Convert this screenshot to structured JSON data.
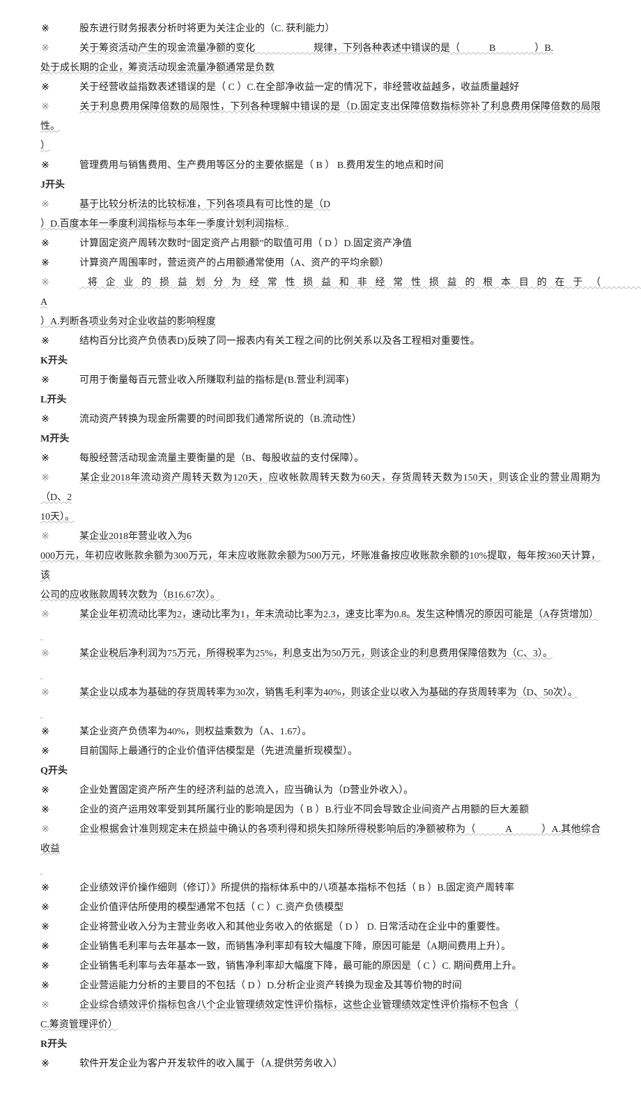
{
  "bullets": {
    "solid": "※",
    "hollow": "※"
  },
  "lines": [
    {
      "type": "item",
      "bullet": "solid",
      "text": "股东进行财务报表分析时将更为关注企业的（C. 获利能力）"
    },
    {
      "type": "item",
      "bullet": "hollow",
      "text": "关于筹资活动产生的现金流量净额的变化　　　　　　规律，下列各种表述中错误的是（　　　B　　　　）B.",
      "wavy": true
    },
    {
      "type": "cont",
      "text": "处于成长期的企业，筹资活动现金流量净额通常是负数",
      "wavy": true
    },
    {
      "type": "item",
      "bullet": "solid",
      "text": "关于经营收益指数表述错误的是（ C ）C.在全部净收益一定的情况下，非经营收益越多，收益质量越好"
    },
    {
      "type": "item",
      "bullet": "hollow",
      "text": "关于利息费用保障倍数的局限性，下列各种理解中错误的是（D.固定支出保障倍数指标弥补了利息费用保障倍数的局限性。",
      "wavy": true
    },
    {
      "type": "cont",
      "text": "）",
      "wavy": true
    },
    {
      "type": "item",
      "bullet": "solid",
      "text": "管理费用与销售费用、生产费用等区分的主要依据是（ B ）  B.费用发生的地点和时间"
    },
    {
      "type": "head",
      "text": "J开头"
    },
    {
      "type": "item",
      "bullet": "hollow",
      "text": "基于比较分析法的比较标准，下列各项具有可比性的是（D",
      "wavy": true
    },
    {
      "type": "cont",
      "text": "）D.百度本年一季度利润指标与本年一季度计划利润指标..",
      "wavy": true
    },
    {
      "type": "item",
      "bullet": "solid",
      "text": "计算固定资产周转次数时“固定资产占用额”的取值可用（ D ）D.固定资产净值"
    },
    {
      "type": "item",
      "bullet": "solid",
      "text": "计算资产周围率时，营运资产的占用额通常使用（A、资产的平均余额）"
    },
    {
      "type": "item",
      "bullet": "hollow",
      "text": "将企业的损益划分为经常性损益和非经常性损益的根本目的在于（　　　　　　　　　　　　　　　　　　　　　　　　　　A",
      "wavy": true
    },
    {
      "type": "cont",
      "text": "）A.判断各项业务对企业收益的影响程度",
      "wavy": true
    },
    {
      "type": "item",
      "bullet": "solid",
      "text": "结构百分比资产负债表D)反映了同一报表内有关工程之间的比例关系以及各工程相对重要性。"
    },
    {
      "type": "head",
      "text": "K开头"
    },
    {
      "type": "item",
      "bullet": "solid",
      "text": "可用于衡量每百元营业收入所赚取利益的指标是(B.营业利润率)"
    },
    {
      "type": "head",
      "text": "L开头"
    },
    {
      "type": "item",
      "bullet": "solid",
      "text": "流动资产转换为现金所需要的时间即我们通常所说的（B.流动性）"
    },
    {
      "type": "head",
      "text": "M开头"
    },
    {
      "type": "item",
      "bullet": "solid",
      "text": "每股经营活动现金流量主要衡量的是（B、每股收益的支付保障）。"
    },
    {
      "type": "item",
      "bullet": "hollow",
      "text": "某企业2018年流动资产周转天数为120天，应收帐款周转天数为60天，存货周转天数为150天，则该企业的营业周期为（D、2",
      "wavy": true
    },
    {
      "type": "cont",
      "text": "10天）。",
      "wavy": true
    },
    {
      "type": "item",
      "bullet": "hollow",
      "text": "某企业2018年营业收入为6",
      "wavy": true
    },
    {
      "type": "cont",
      "text": "000万元，年初应收账款余额为300万元，年末应收账款余额为500万元，坏账准备按应收账款余额的10%提取，每年按360天计算，该",
      "wavy": true
    },
    {
      "type": "cont",
      "text": "公司的应收账款周转次数为（B16.67次）。",
      "wavy": true
    },
    {
      "type": "item",
      "bullet": "hollow",
      "text": "某企业年初流动比率为2，速动比率为1，年末流动比率为2.3，速支比率为0.8。发生这种情况的原因可能是（A存货增加）",
      "wavy": true
    },
    {
      "type": "cont",
      "text": " ",
      "wavy": true
    },
    {
      "type": "item",
      "bullet": "hollow",
      "text": "某企业税后净利润为75万元，所得税率为25%，利息支出为50万元，则该企业的利息费用保障倍数为（C、3）。",
      "wavy": true
    },
    {
      "type": "cont",
      "text": " ",
      "wavy": true
    },
    {
      "type": "item",
      "bullet": "hollow",
      "text": "某企业以成本为基础的存货周转率为30次，销售毛利率为40%，则该企业以收入为基础的存货周转率为（D、50次）。",
      "wavy": true
    },
    {
      "type": "cont",
      "text": " ",
      "wavy": true
    },
    {
      "type": "item",
      "bullet": "solid",
      "text": "某企业资产负债率为40%，则权益乘数为（A、1.67）。"
    },
    {
      "type": "item",
      "bullet": "solid",
      "text": "目前国际上最通行的企业价值评估模型是（先进流量折现模型）。"
    },
    {
      "type": "head",
      "text": "Q开头"
    },
    {
      "type": "item",
      "bullet": "solid",
      "text": "企业处置固定资产所产生的经济利益的总流入，应当确认为（D营业外收入）。"
    },
    {
      "type": "item",
      "bullet": "solid",
      "text": "企业的资产运用效率受到其所属行业的影响是因为（ B ）B.行业不同会导致企业间资产占用额的巨大差额"
    },
    {
      "type": "item",
      "bullet": "hollow",
      "text": "企业根据会计准则规定未在损益中确认的各项利得和损失扣除所得税影响后的净额被称为（　　　A　　　）A.其他综合收益",
      "wavy": true
    },
    {
      "type": "cont",
      "text": " ",
      "wavy": true
    },
    {
      "type": "item",
      "bullet": "solid",
      "text": "企业绩效评价操作细则（修订）》所提供的指标体系中的八项基本指标不包括（ B ）B.固定资产周转率"
    },
    {
      "type": "item",
      "bullet": "solid",
      "text": "企业价值评估所使用的模型通常不包括（ C ）C.资产负债模型"
    },
    {
      "type": "item",
      "bullet": "solid",
      "text": "企业将营业收入分为主营业务收入和其他业务收入的依据是（ D ）  D. 日常活动在企业中的重要性。"
    },
    {
      "type": "item",
      "bullet": "solid",
      "text": "企业销售毛利率与去年基本一致，而销售净利率却有较大幅度下降，原因可能是（A期间费用上升）。"
    },
    {
      "type": "item",
      "bullet": "solid",
      "text": "企业销售毛利率与去年基本一致，销售净利率却大幅度下降，最可能的原因是（ C ）C. 期间费用上升。"
    },
    {
      "type": "item",
      "bullet": "solid",
      "text": "企业营运能力分析的主要目的不包括（ D  ）D.分析企业资产转换为现金及其等价物的时间"
    },
    {
      "type": "item",
      "bullet": "hollow",
      "text": "企业综合绩效评价指标包含八个企业管理绩效定性评价指标，这些企业管理绩效定性评价指标不包含（",
      "wavy": true
    },
    {
      "type": "cont",
      "text": "C.筹资管理评价）",
      "wavy": true
    },
    {
      "type": "head",
      "text": "R开头"
    },
    {
      "type": "item",
      "bullet": "solid",
      "text": "软件开发企业为客户开发软件的收入属于（A.提供劳务收入）"
    }
  ]
}
